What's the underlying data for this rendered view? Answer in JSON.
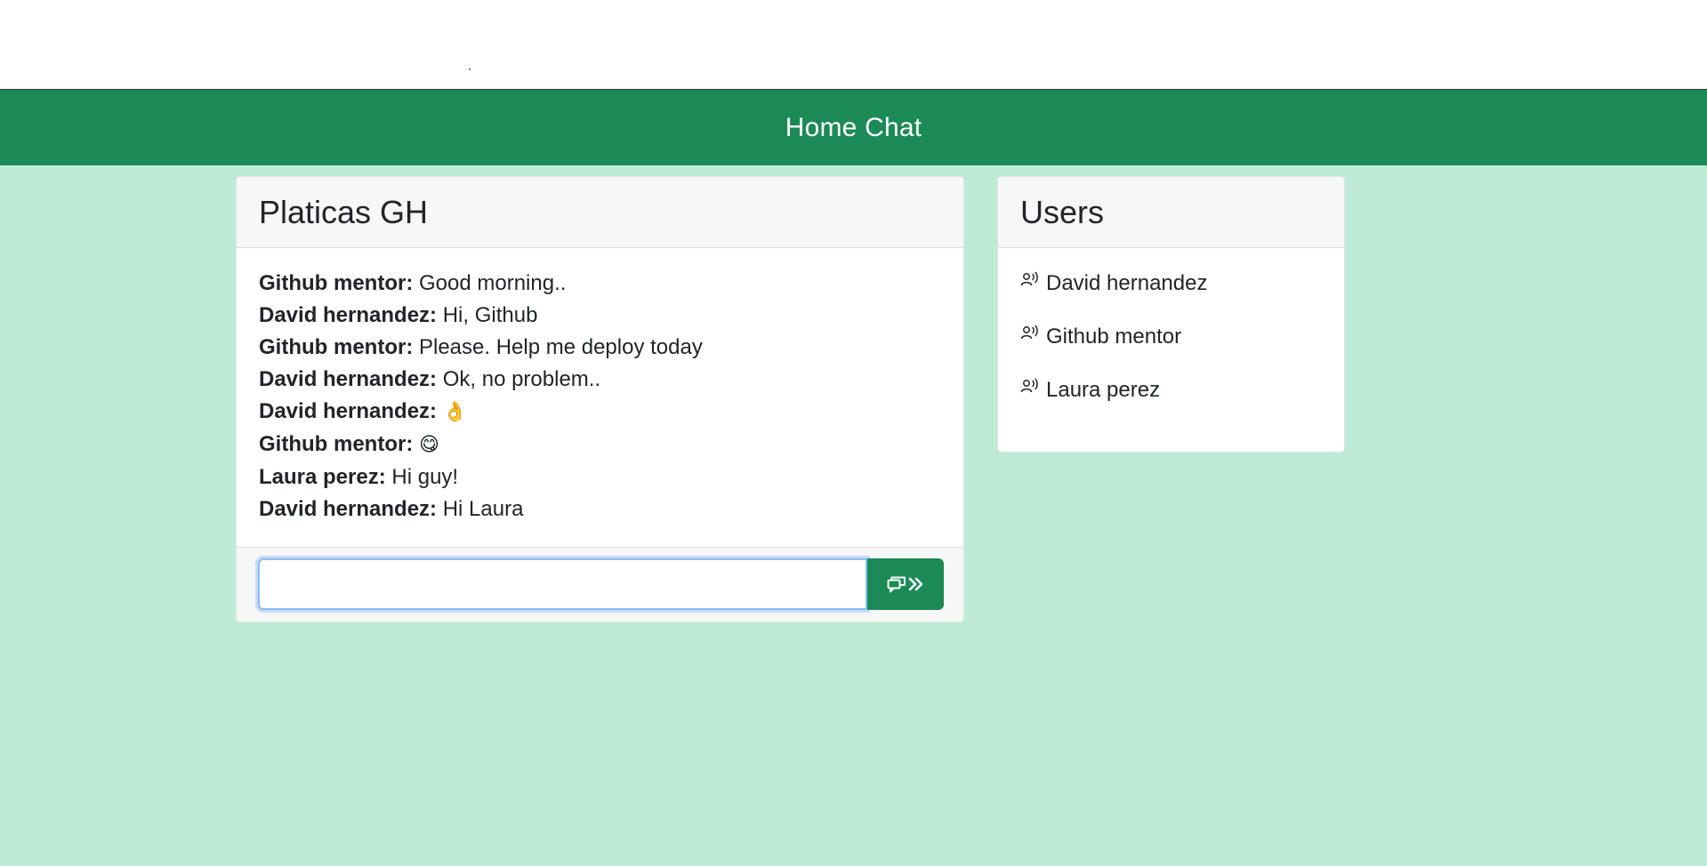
{
  "navbar": {
    "title": "Home Chat"
  },
  "chat": {
    "title": "Platicas GH",
    "messages": [
      {
        "author": "Github mentor:",
        "text": "Good morning..",
        "emoji": ""
      },
      {
        "author": "David hernandez:",
        "text": "Hi, Github",
        "emoji": ""
      },
      {
        "author": "Github mentor:",
        "text": "Please. Help me deploy today",
        "emoji": ""
      },
      {
        "author": "David hernandez:",
        "text": "Ok, no problem..",
        "emoji": ""
      },
      {
        "author": "David hernandez:",
        "text": "",
        "emoji": "👌"
      },
      {
        "author": "Github mentor:",
        "text": "",
        "emoji": "😋"
      },
      {
        "author": "Laura perez:",
        "text": "Hi guy!",
        "emoji": ""
      },
      {
        "author": "David hernandez:",
        "text": "Hi Laura",
        "emoji": ""
      }
    ],
    "input": {
      "value": "",
      "placeholder": ""
    },
    "send_button_icons": [
      "chat-icon",
      "chevron-double-right-icon"
    ]
  },
  "users": {
    "title": "Users",
    "items": [
      {
        "name": "David hernandez",
        "icon": "person-voice-icon"
      },
      {
        "name": "Github mentor",
        "icon": "person-voice-icon"
      },
      {
        "name": "Laura perez",
        "icon": "person-voice-icon"
      }
    ]
  },
  "colors": {
    "navbar": "#1b8a56",
    "background": "#bdebd6",
    "send_button": "#1b8a56",
    "input_focus": "#8bbcf0"
  }
}
